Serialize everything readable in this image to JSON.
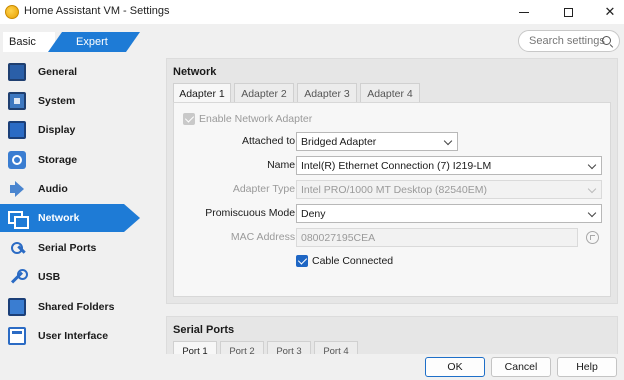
{
  "window": {
    "title": "Home Assistant VM - Settings",
    "minimize_label": "",
    "maximize_label": "",
    "close_label": "✕"
  },
  "mode": {
    "basic": "Basic",
    "expert": "Expert",
    "active": "Expert"
  },
  "search": {
    "placeholder": "Search settings"
  },
  "sidebar": {
    "items": [
      {
        "label": "General",
        "icon": "general-icon"
      },
      {
        "label": "System",
        "icon": "system-icon"
      },
      {
        "label": "Display",
        "icon": "display-icon"
      },
      {
        "label": "Storage",
        "icon": "storage-icon"
      },
      {
        "label": "Audio",
        "icon": "audio-icon"
      },
      {
        "label": "Network",
        "icon": "network-icon",
        "active": true
      },
      {
        "label": "Serial Ports",
        "icon": "serial-ports-icon"
      },
      {
        "label": "USB",
        "icon": "usb-icon"
      },
      {
        "label": "Shared Folders",
        "icon": "shared-folders-icon"
      },
      {
        "label": "User Interface",
        "icon": "user-interface-icon"
      }
    ]
  },
  "network": {
    "section_title": "Network",
    "tabs": [
      "Adapter 1",
      "Adapter 2",
      "Adapter 3",
      "Adapter 4"
    ],
    "active_tab": "Adapter 1",
    "enable_adapter_label": "Enable Network Adapter",
    "enable_adapter_checked": true,
    "attached_to_label": "Attached to:",
    "attached_to_value": "Bridged Adapter",
    "name_label": "Name:",
    "name_value": "Intel(R) Ethernet Connection (7) I219-LM",
    "adapter_type_label": "Adapter Type:",
    "adapter_type_value": "Intel PRO/1000 MT Desktop (82540EM)",
    "promiscuous_label": "Promiscuous Mode:",
    "promiscuous_value": "Deny",
    "mac_label": "MAC Address:",
    "mac_value": "080027195CEA",
    "cable_connected_label": "Cable Connected",
    "cable_connected_checked": true
  },
  "serial": {
    "section_title": "Serial Ports",
    "tabs": [
      "Port 1",
      "Port 2",
      "Port 3",
      "Port 4"
    ]
  },
  "buttons": {
    "ok": "OK",
    "cancel": "Cancel",
    "help": "Help"
  },
  "colors": {
    "accent": "#1e7bd6",
    "window_bg": "#f0f0f0"
  }
}
